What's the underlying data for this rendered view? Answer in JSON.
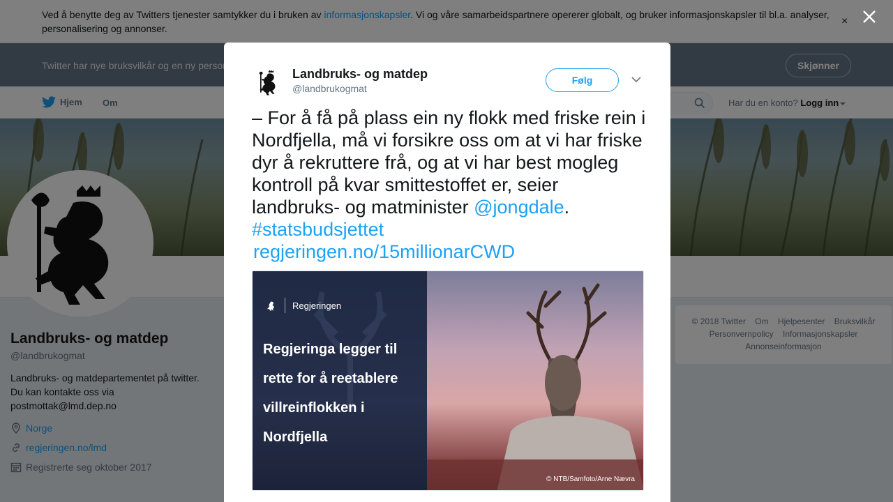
{
  "cookie_banner": {
    "text_before": "Ved å benytte deg av Twitters tjenester samtykker du i bruken av ",
    "link": "informasjonskapsler",
    "text_after": ". Vi og våre samarbeidspartnere opererer globalt, og bruker informasjonskapsler til bl.a. analyser, personalisering og annonser.",
    "close": "×"
  },
  "terms_bar": {
    "text": "Twitter har nye bruksvilkår og en ny personvernpolicy",
    "button": "Skjønner"
  },
  "topnav": {
    "home": "Hjem",
    "about": "Om",
    "account_prompt": "Har du en konto?",
    "login": "Logg inn"
  },
  "profile": {
    "name": "Landbruks- og matdep",
    "handle": "@landbrukogmat",
    "bio": "Landbruks- og matdepartementet på twitter. Du kan kontakte oss via postmottak@lmd.dep.no",
    "location": "Norge",
    "website": "regjeringen.no/lmd",
    "joined": "Registrerte seg oktober 2017"
  },
  "footer": {
    "items": [
      "© 2018 Twitter",
      "Om",
      "Hjelpesenter",
      "Bruksvilkår",
      "Personvernpolicy",
      "Informasjonskapsler",
      "Annonseinformasjon"
    ]
  },
  "modal": {
    "name": "Landbruks- og matdep",
    "handle": "@landbrukogmat",
    "follow": "Følg",
    "tweet_text": "– For å få på plass ein ny flokk med friske rein i Nordfjella, må vi forsikre oss om at vi har friske dyr å rekruttere frå, og at vi har best mogleg kontroll på kvar smittestoffet er, seier landbruks- og matminister ",
    "mention": "@jongdale",
    "period": ".",
    "hashtag": "#statsbudsjettet",
    "link": "regjeringen.no/15millionarCWD",
    "media": {
      "brand": "Regjeringen",
      "headline": "Regjeringa legger til rette for å reetablere villreinflokken i Nordfjella",
      "credit": "© NTB/Samfoto/Arne Nævra"
    }
  },
  "icons": {
    "twitter": "twitter-bird-icon",
    "search": "search-icon",
    "location": "location-pin-icon",
    "link": "link-icon",
    "calendar": "calendar-icon",
    "close": "close-icon",
    "chevron": "chevron-down-icon"
  },
  "colors": {
    "accent": "#1da1f2",
    "terms_bar": "#657786"
  }
}
